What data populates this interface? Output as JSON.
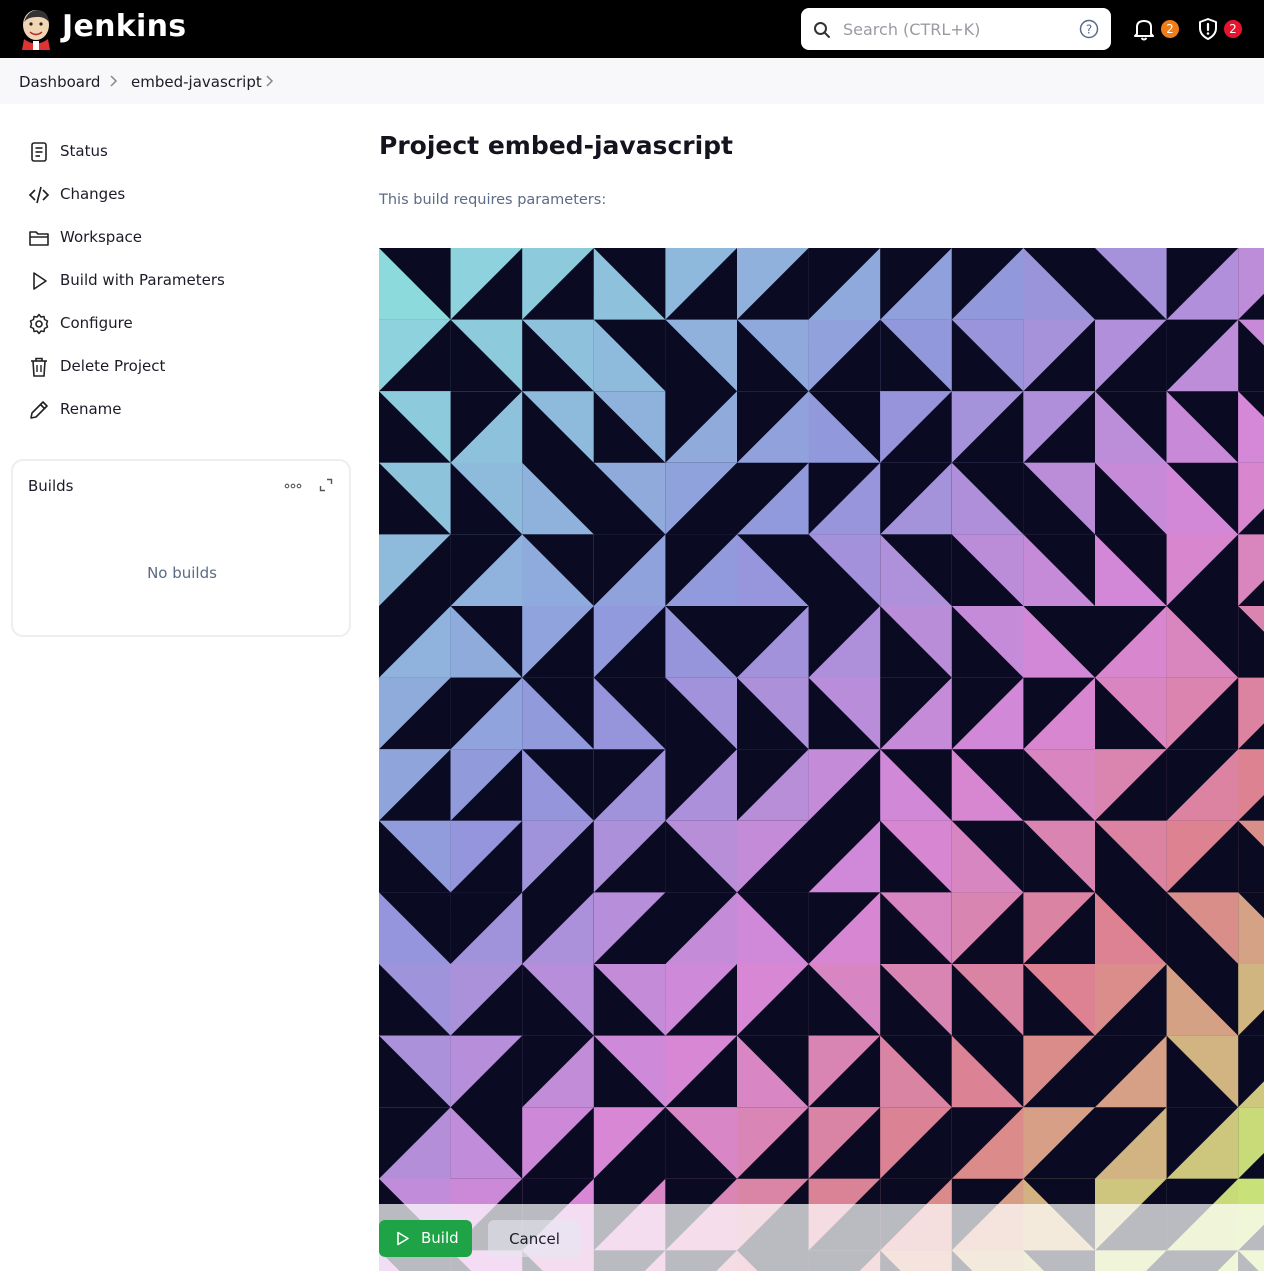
{
  "header": {
    "brand": "Jenkins",
    "search_placeholder": "Search (CTRL+K)",
    "notifications_count": "2",
    "security_count": "2"
  },
  "breadcrumb": {
    "items": [
      "Dashboard",
      "embed-javascript"
    ]
  },
  "sidebar": {
    "items": [
      {
        "label": "Status",
        "icon": "status-icon"
      },
      {
        "label": "Changes",
        "icon": "code-icon"
      },
      {
        "label": "Workspace",
        "icon": "folder-icon"
      },
      {
        "label": "Build with Parameters",
        "icon": "play-icon"
      },
      {
        "label": "Configure",
        "icon": "gear-icon"
      },
      {
        "label": "Delete Project",
        "icon": "trash-icon"
      },
      {
        "label": "Rename",
        "icon": "pencil-icon"
      }
    ]
  },
  "builds": {
    "title": "Builds",
    "empty": "No builds"
  },
  "main": {
    "title": "Project embed-javascript",
    "subtitle": "This build requires parameters:"
  },
  "footer": {
    "build_label": "Build",
    "cancel_label": "Cancel"
  },
  "colors": {
    "header_bg": "#000000",
    "build_green": "#1ea446",
    "notif_badge": "#f07d1a",
    "security_badge": "#e8132e",
    "art_dark": "#0a0a22"
  }
}
